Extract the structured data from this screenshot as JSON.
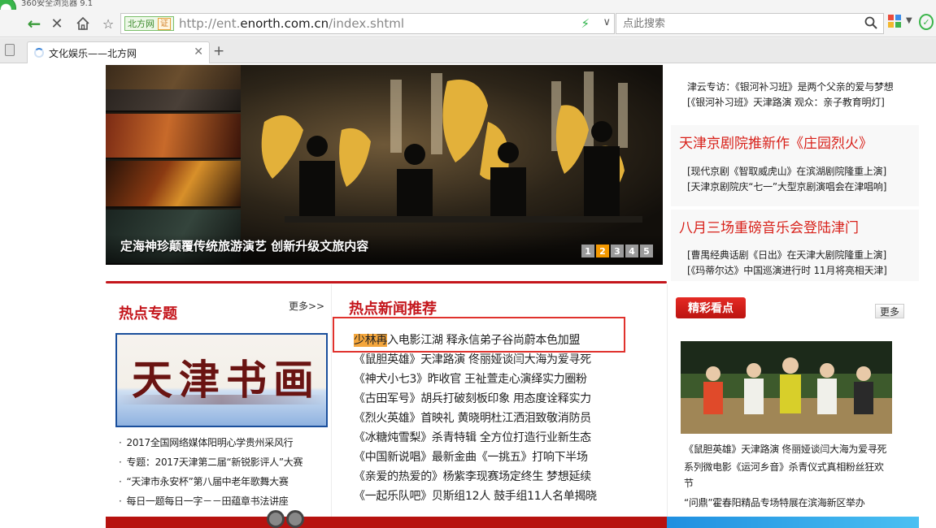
{
  "window": {
    "title": "360安全浏览器 9.1"
  },
  "toolbar": {
    "site_badge": "北方网",
    "cert_badge": "证",
    "url_prefix": "http://ent.",
    "url_domain": "enorth.com.cn",
    "url_path": "/index.shtml",
    "search_placeholder": "点此搜索"
  },
  "tab": {
    "title": "文化娱乐——北方网"
  },
  "slideshow": {
    "caption": "定海神珍颠覆传统旅游演艺 创新升级文旅内容",
    "pages": [
      "1",
      "2",
      "3",
      "4",
      "5"
    ],
    "active_page": 2
  },
  "right_news": {
    "top_lines": [
      "津云专访：《银河补习班》是两个父亲的爱与梦想",
      "[《银河补习班》天津路演 观众：亲子教育明灯]"
    ],
    "blocks": [
      {
        "heading": "天津京剧院推新作《庄园烈火》",
        "lines": [
          "[现代京剧《智取威虎山》在滨湖剧院隆重上演]",
          "[天津京剧院庆“七一”大型京剧演唱会在津唱响]"
        ]
      },
      {
        "heading": "八月三场重磅音乐会登陆津门",
        "lines": [
          "[曹禺经典话剧《日出》在天津大剧院隆重上演]",
          "[《玛蒂尔达》中国巡演进行时 11月将亮相天津]"
        ]
      }
    ]
  },
  "hot_topics": {
    "title": "热点专题",
    "more": "更多>>",
    "banner_text": "天津书画",
    "items": [
      "2017全国网络媒体阳明心学贵州采风行",
      "专题：2017天津第二届“新锐影评人”大赛",
      "“天津市永安杯”第八届中老年歌舞大赛",
      "每日一题每日一字－－田蕴章书法讲座"
    ]
  },
  "hot_news": {
    "title": "热点新闻推荐",
    "highlight": "少林再",
    "items": [
      "少林再入电影江湖  释永信弟子谷尚蔚本色加盟",
      "《鼠胆英雄》天津路演 佟丽娅谈闫大海为爱寻死",
      "《神犬小七3》昨收官 王祉萱走心演绎实力圈粉",
      "《古田军号》胡兵打破刻板印象  用态度诠释实力",
      "《烈火英雄》首映礼 黄晓明杜江洒泪致敬消防员",
      "《冰糖炖雪梨》杀青特辑  全方位打造行业新生态",
      "《中国新说唱》最新金曲《一挑五》打响下半场",
      "《亲爱的热爱的》杨紫李现赛场定终生  梦想延续",
      "《一起乐队吧》贝斯组12人  鼓手组11人名单揭晓"
    ]
  },
  "featured": {
    "badge": "精彩看点",
    "more": "更多",
    "captions": [
      "《鼠胆英雄》天津路演 佟丽娅谈闫大海为爱寻死",
      "系列微电影《运河乡音》杀青仪式真相粉丝狂欢",
      "节",
      "“问鼎”霍春阳精品专场特展在滨海新区举办"
    ]
  },
  "colors": {
    "accent_red": "#c4161c",
    "highlight_orange": "#f4a63c",
    "pager_active": "#f39800",
    "focus_box": "#e0322d"
  }
}
